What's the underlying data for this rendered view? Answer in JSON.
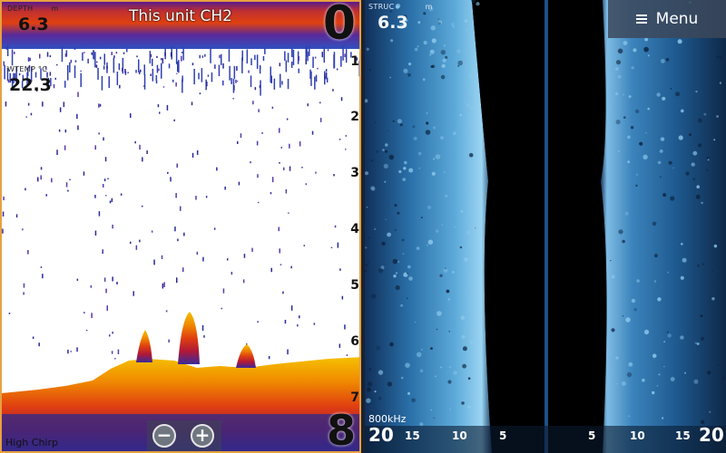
{
  "left": {
    "depth_label": "DEPTH",
    "depth_unit": "m",
    "depth_value": "6.3",
    "temp_label": "WTEMP",
    "temp_unit": "°C",
    "temp_value": "22.3",
    "title": "This unit CH2",
    "range_top": "0",
    "range_bottom": "8",
    "depth_ticks": [
      "1",
      "2",
      "3",
      "4",
      "5",
      "6",
      "7"
    ],
    "frequency": "High Chirp",
    "zoom_out_label": "−",
    "zoom_in_label": "+"
  },
  "right": {
    "depth_label": "STRUC",
    "depth_unit": "m",
    "depth_value": "6.3",
    "menu_label": "Menu",
    "frequency": "800kHz",
    "range_labels": [
      "20",
      "15",
      "10",
      "5",
      "5",
      "10",
      "15",
      "20"
    ]
  },
  "colors": {
    "border_accent": "#e8a040",
    "sonar_background": "#ffffff",
    "bottom_hot": "#f5c000",
    "bottom_mid": "#e04010",
    "structure_water": "#0a1a30",
    "structure_bright": "#6fb8e6"
  }
}
